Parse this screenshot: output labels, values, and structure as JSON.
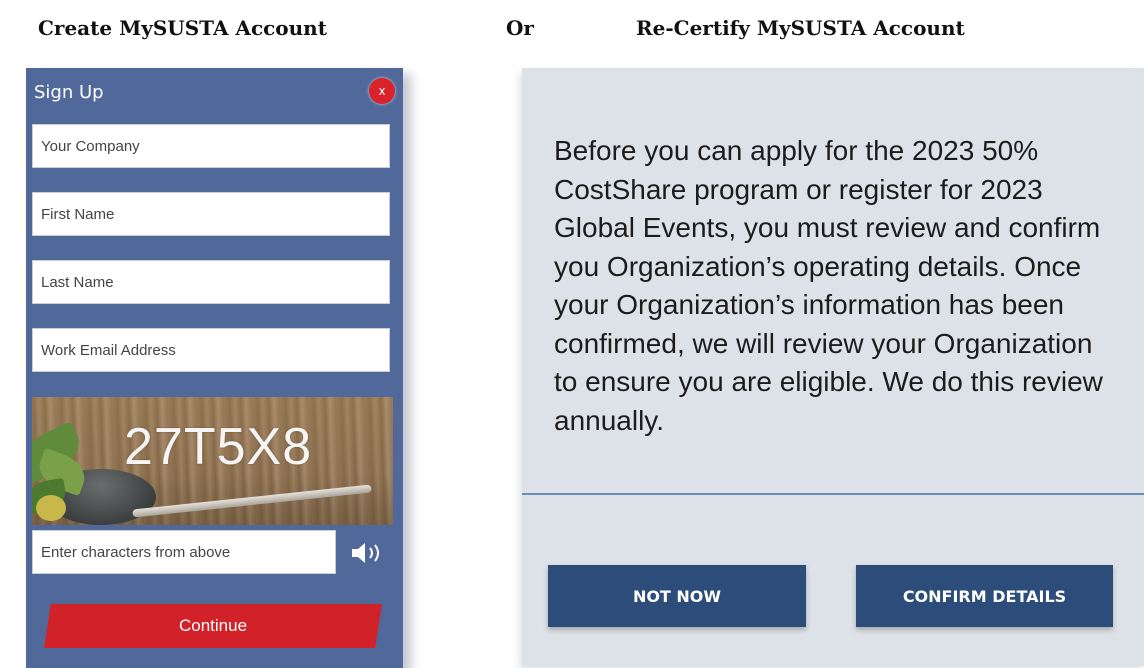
{
  "headings": {
    "create": "Create MySUSTA Account",
    "or": "Or",
    "recertify": "Re-Certify MySUSTA Account"
  },
  "signup": {
    "title": "Sign Up",
    "close_label": "x",
    "fields": {
      "company_placeholder": "Your Company",
      "first_name_placeholder": "First Name",
      "last_name_placeholder": "Last Name",
      "email_placeholder": "Work Email Address"
    },
    "captcha_code": "27T5X8",
    "captcha_input_placeholder": "Enter characters from above",
    "audio_icon": "speaker-icon",
    "continue_label": "Continue",
    "colors": {
      "panel": "#50689a",
      "accent": "#d1222a"
    }
  },
  "recertify": {
    "message": "Before you can apply for the 2023 50% CostShare program or register for 2023 Global Events, you must review and confirm you Organization’s operating details. Once your Organization’s information has been confirmed, we will review your Organization to ensure you are eligible. We do this review annually.",
    "not_now_label": "NOT NOW",
    "confirm_label": "CONFIRM DETAILS",
    "colors": {
      "panel": "#dde2e8",
      "button": "#2c4d7a"
    }
  }
}
